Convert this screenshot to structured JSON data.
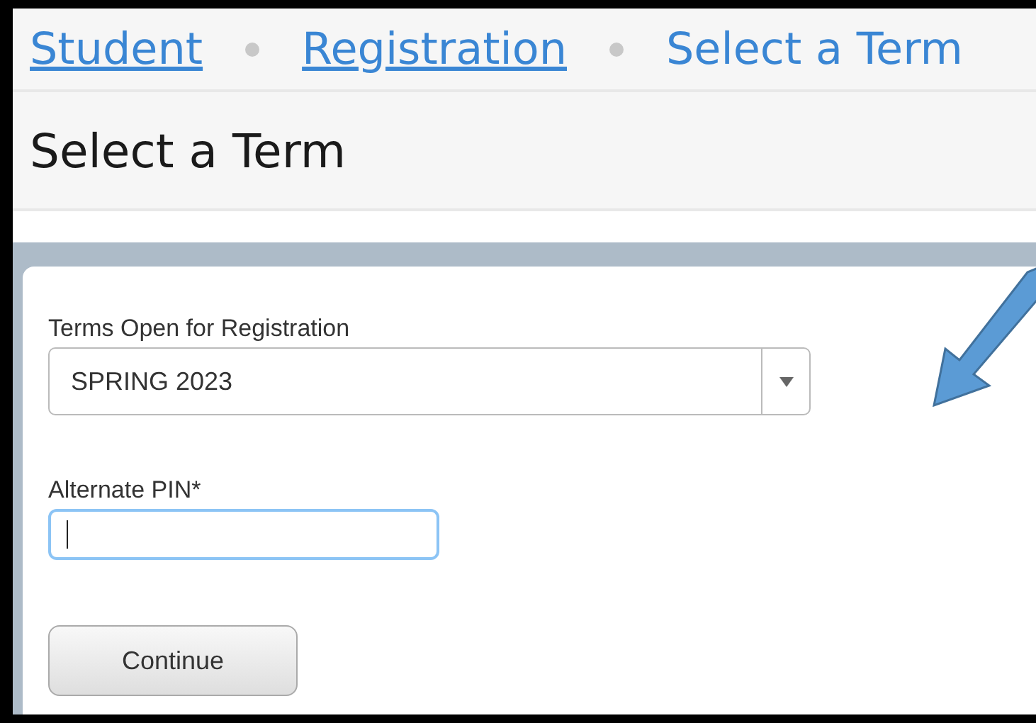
{
  "breadcrumb": [
    {
      "label": "Student",
      "current": false
    },
    {
      "label": "Registration",
      "current": false
    },
    {
      "label": "Select a Term",
      "current": true
    }
  ],
  "page_title": "Select a Term",
  "form": {
    "term": {
      "label": "Terms Open for Registration",
      "value": "SPRING 2023"
    },
    "pin": {
      "label": "Alternate PIN*",
      "focused": true
    },
    "button": "Continue"
  }
}
